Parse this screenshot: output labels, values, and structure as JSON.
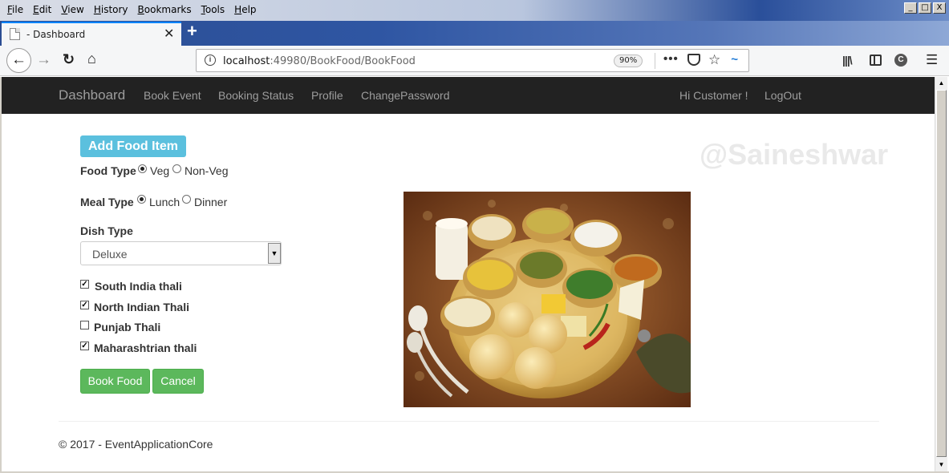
{
  "browser": {
    "menus": [
      "File",
      "Edit",
      "View",
      "History",
      "Bookmarks",
      "Tools",
      "Help"
    ],
    "tab_title": "- Dashboard",
    "new_tab": "+",
    "url_host": "localhost",
    "url_path": ":49980/BookFood/BookFood",
    "zoom": "90%",
    "window_minimize": "_",
    "window_restore": "□",
    "window_close": "X"
  },
  "site_nav": {
    "brand": "Dashboard",
    "links": [
      "Book Event",
      "Booking Status",
      "Profile",
      "ChangePassword"
    ],
    "greeting": "Hi Customer !",
    "logout": "LogOut"
  },
  "page": {
    "add_food_button": "Add Food Item",
    "watermark": "@Saineshwar",
    "food_type": {
      "label": "Food Type",
      "options": [
        {
          "label": "Veg",
          "checked": true
        },
        {
          "label": "Non-Veg",
          "checked": false
        }
      ]
    },
    "meal_type": {
      "label": "Meal Type",
      "options": [
        {
          "label": "Lunch",
          "checked": true
        },
        {
          "label": "Dinner",
          "checked": false
        }
      ]
    },
    "dish_type": {
      "label": "Dish Type",
      "selected": "Deluxe"
    },
    "dishes": [
      {
        "label": "South India thali",
        "checked": true
      },
      {
        "label": "North Indian Thali",
        "checked": true
      },
      {
        "label": "Punjab Thali",
        "checked": false
      },
      {
        "label": "Maharashtrian thali",
        "checked": true
      }
    ],
    "book_button": "Book Food",
    "cancel_button": "Cancel",
    "footer": "© 2017 - EventApplicationCore"
  },
  "colors": {
    "navbar_bg": "#222222",
    "nav_link": "#9d9d9d",
    "info_button": "#5bc0de",
    "success_button": "#5cb85c"
  }
}
